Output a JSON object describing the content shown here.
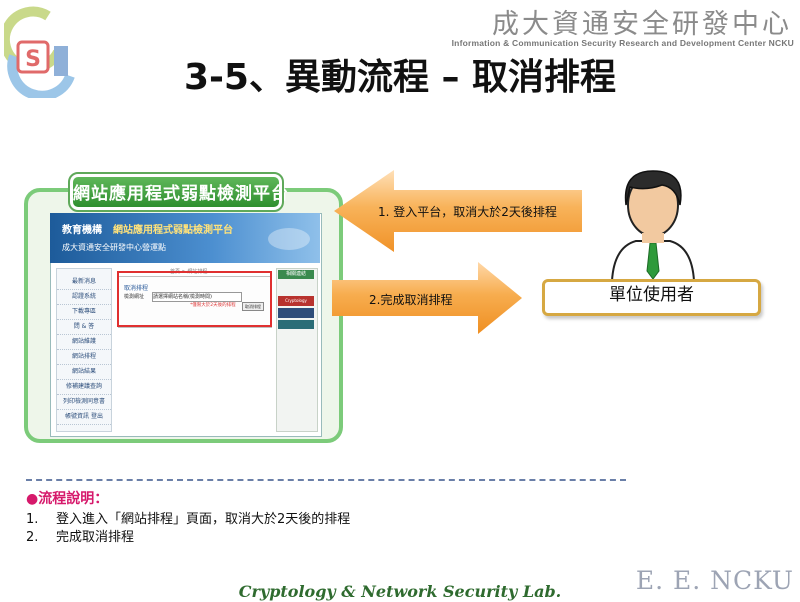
{
  "header": {
    "org_name_cn": "成大資通安全研發中心",
    "org_name_en": "Information & Communication Security Research and Development Center NCKU",
    "logo_letters": "S",
    "title": "3-5、異動流程 – 取消排程"
  },
  "platform": {
    "tab_title": "網站應用程式弱點檢測平台",
    "site_brand": "教育機構",
    "site_brand_title": "網站應用程式弱點檢測平台",
    "site_subtitle": "成大資通安全研發中心營運點",
    "nav_items": [
      "最新消息",
      "認證系統",
      "下載專區",
      "問 & 答",
      "網站維護",
      "網站排程",
      "網站結果",
      "修補建議查詢",
      "列印檢測同意書",
      "帳號資訊 登出"
    ],
    "breadcrumb": "首頁 > 網站排程",
    "form_title": "取消排程",
    "form_label": "檢測網址",
    "form_select_value": "請選擇網站名稱(檢測時間)",
    "form_note": "*僅限大於2天後的排程",
    "form_button": "取消排程",
    "side_header": "相關連結",
    "side_box_text": "Cryptology"
  },
  "arrows": {
    "login_text": "1. 登入平台，取消大於2天後排程",
    "complete_text": "2.完成取消排程"
  },
  "user": {
    "label": "單位使用者"
  },
  "notes": {
    "title": "●流程說明：",
    "items": [
      {
        "num": "1.",
        "text": "登入進入「網站排程」頁面，取消大於2天後的排程"
      },
      {
        "num": "2.",
        "text": "完成取消排程"
      }
    ]
  },
  "footer": {
    "lab_name": "Cryptology & Network Security Lab.",
    "ee_ncku": "E. E. NCKU"
  },
  "colors": {
    "accent_green": "#5fb75a",
    "arrow_orange": "#f5a33b",
    "highlight_red": "#e03030",
    "note_pink": "#d6196b",
    "user_border": "#d6a842"
  }
}
